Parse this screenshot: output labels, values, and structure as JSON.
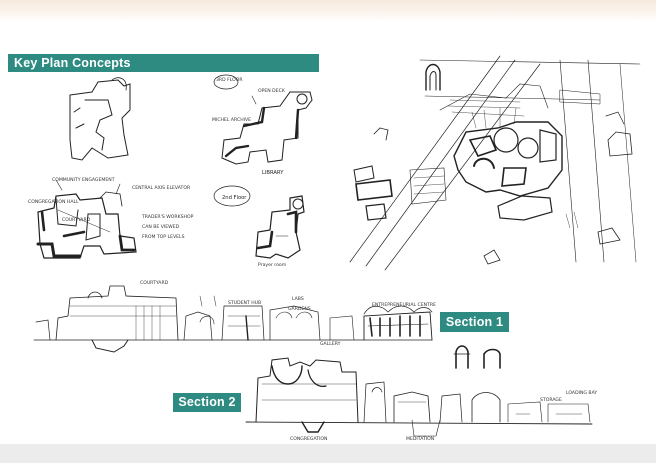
{
  "labels": {
    "title": "Key Plan Concepts",
    "section1": "Section 1",
    "section2": "Section 2"
  },
  "sketch_notes": {
    "note_3rd_floor": "3RD FLOOR",
    "note_open_deck": "OPEN DECK",
    "note_archive": "MICHEL ARCHIVE",
    "note_library": "LIBRARY",
    "note_community": "COMMUNITY ENGAGEMENT",
    "note_central": "CENTRAL AXIS ELEVATOR",
    "note_congregation": "CONGREGATION HALL",
    "note_courtyard": "COURTYARD",
    "note_trader": "TRADER'S WORKSHOP",
    "note_viewed": "CAN BE VIEWED",
    "note_top": "FROM TOP LEVELS",
    "note_2nd_floor": "2nd Floor",
    "note_prayer": "Prayer room",
    "note_courtyard_sec": "COURTYARD",
    "note_student": "STUDENT HUB",
    "note_labs": "LABS",
    "note_gardens": "GARDENS",
    "note_entrepreneur": "ENTREPRENEURIAL CENTRE",
    "note_gallery": "GALLERY",
    "note_loading": "LOADING BAY",
    "note_storage": "STORAGE",
    "note_meditation": "MEDITATION",
    "note_congregation_sec": "CONGREGATION"
  },
  "colors": {
    "accent": "#2e8b82",
    "ink": "#222222"
  }
}
